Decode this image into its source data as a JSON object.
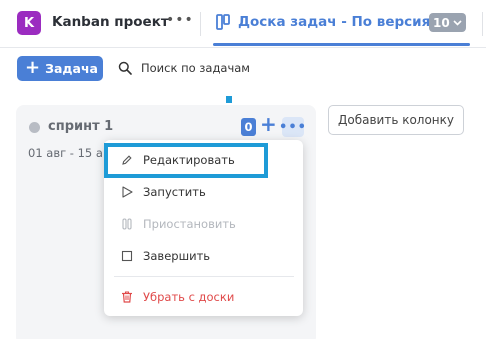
{
  "project": {
    "avatar_letter": "K",
    "name": "Kanban проект",
    "more": "•••"
  },
  "board": {
    "title": "Доска задач - По версиям",
    "count": "10"
  },
  "toolbar": {
    "add_task_plus": "+",
    "add_task_label": "Задача",
    "search_placeholder": "Поиск по задачам"
  },
  "column": {
    "title": "спринт 1",
    "dates": "01 авг - 15 ав",
    "task_count": "0",
    "add": "+",
    "more": "•••"
  },
  "add_column_label": "Добавить колонку",
  "menu": {
    "items": [
      {
        "label": "Редактировать",
        "icon": "pencil-icon"
      },
      {
        "label": "Запустить",
        "icon": "play-icon"
      },
      {
        "label": "Приостановить",
        "icon": "pause-icon"
      },
      {
        "label": "Завершить",
        "icon": "stop-icon"
      },
      {
        "label": "Убрать с доски",
        "icon": "trash-icon"
      }
    ]
  },
  "colors": {
    "accent": "#4a7fd6",
    "project": "#9b2cc0",
    "highlight": "#1e9bd7",
    "danger": "#e04a4a"
  }
}
